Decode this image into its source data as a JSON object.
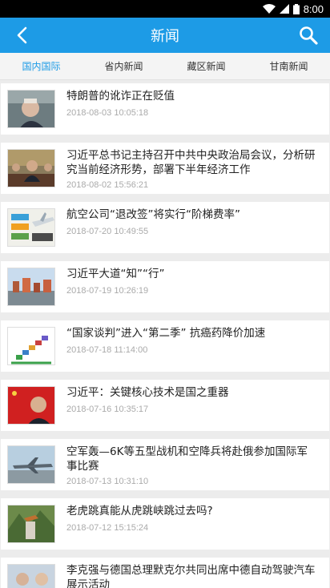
{
  "status": {
    "time": "8:00"
  },
  "header": {
    "title": "新闻"
  },
  "tabs": [
    {
      "label": "国内国际"
    },
    {
      "label": "省内新闻"
    },
    {
      "label": "藏区新闻"
    },
    {
      "label": "甘南新闻"
    }
  ],
  "articles": [
    {
      "title": "特朗普的讹诈正在贬值",
      "date": "2018-08-03 10:05:18"
    },
    {
      "title": "习近平总书记主持召开中共中央政治局会议，分析研究当前经济形势，部署下半年经济工作",
      "date": "2018-08-02 15:56:21"
    },
    {
      "title": "航空公司“退改签”将实行“阶梯费率”",
      "date": "2018-07-20 10:49:55"
    },
    {
      "title": "习近平大道“知”“行”",
      "date": "2018-07-19 10:26:19"
    },
    {
      "title": "“国家谈判”进入“第二季” 抗癌药降价加速",
      "date": "2018-07-18 11:14:00"
    },
    {
      "title": "习近平：关键核心技术是国之重器",
      "date": "2018-07-16 10:35:17"
    },
    {
      "title": "空军轰—6K等五型战机和空降兵将赴俄参加国际军事比赛",
      "date": "2018-07-13 10:31:10"
    },
    {
      "title": "老虎跳真能从虎跳峡跳过去吗?",
      "date": "2018-07-12 15:15:24"
    },
    {
      "title": "李克强与德国总理默克尔共同出席中德自动驾驶汽车展示活动",
      "date": ""
    }
  ]
}
